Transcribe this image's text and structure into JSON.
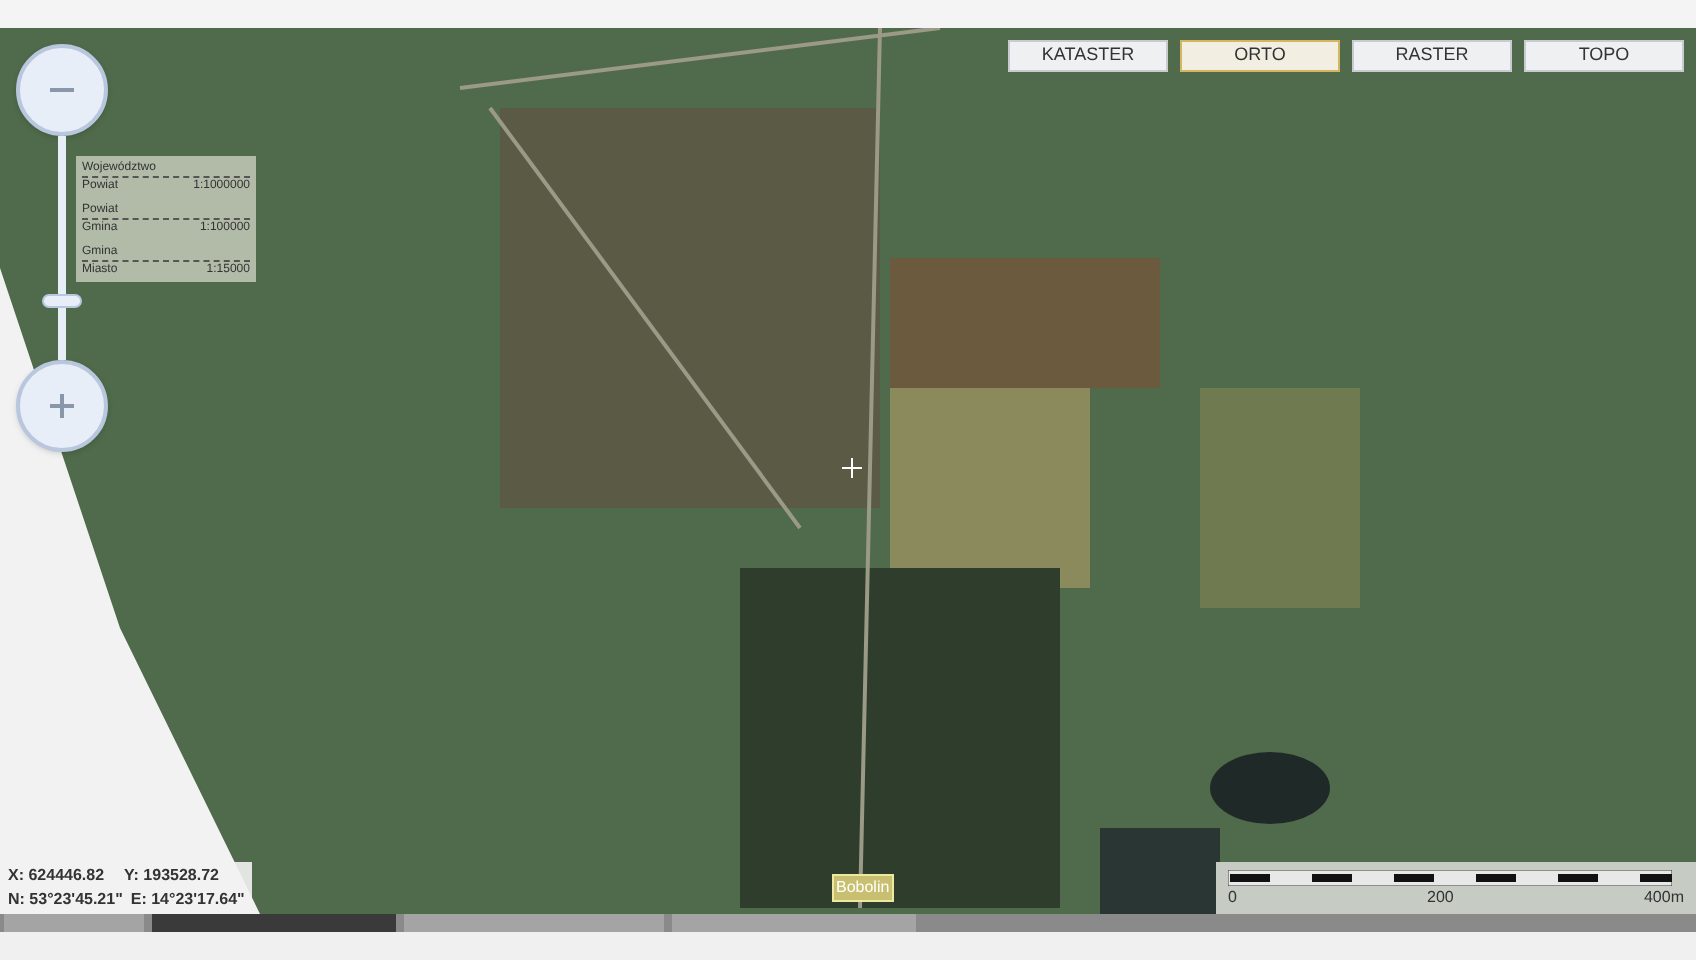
{
  "layers": [
    {
      "label": "KATASTER",
      "selected": false
    },
    {
      "label": "ORTO",
      "selected": true
    },
    {
      "label": "RASTER",
      "selected": false
    },
    {
      "label": "TOPO",
      "selected": false
    }
  ],
  "zoom": {
    "level": 0.26
  },
  "scale_levels": [
    {
      "upper": "Województwo",
      "lower": "Powiat",
      "ratio": "1:1000000"
    },
    {
      "upper": "Powiat",
      "lower": "Gmina",
      "ratio": "1:100000"
    },
    {
      "upper": "Gmina",
      "lower": "Miasto",
      "ratio": "1:15000"
    }
  ],
  "place_label": "Bobolin",
  "coordinates": {
    "x": "X: 624446.82",
    "y": "Y: 193528.72",
    "n": "N: 53°23'45.21\"",
    "e": "E: 14°23'17.64\""
  },
  "scale_bar": {
    "ticks": [
      "0",
      "200",
      "400m"
    ]
  }
}
